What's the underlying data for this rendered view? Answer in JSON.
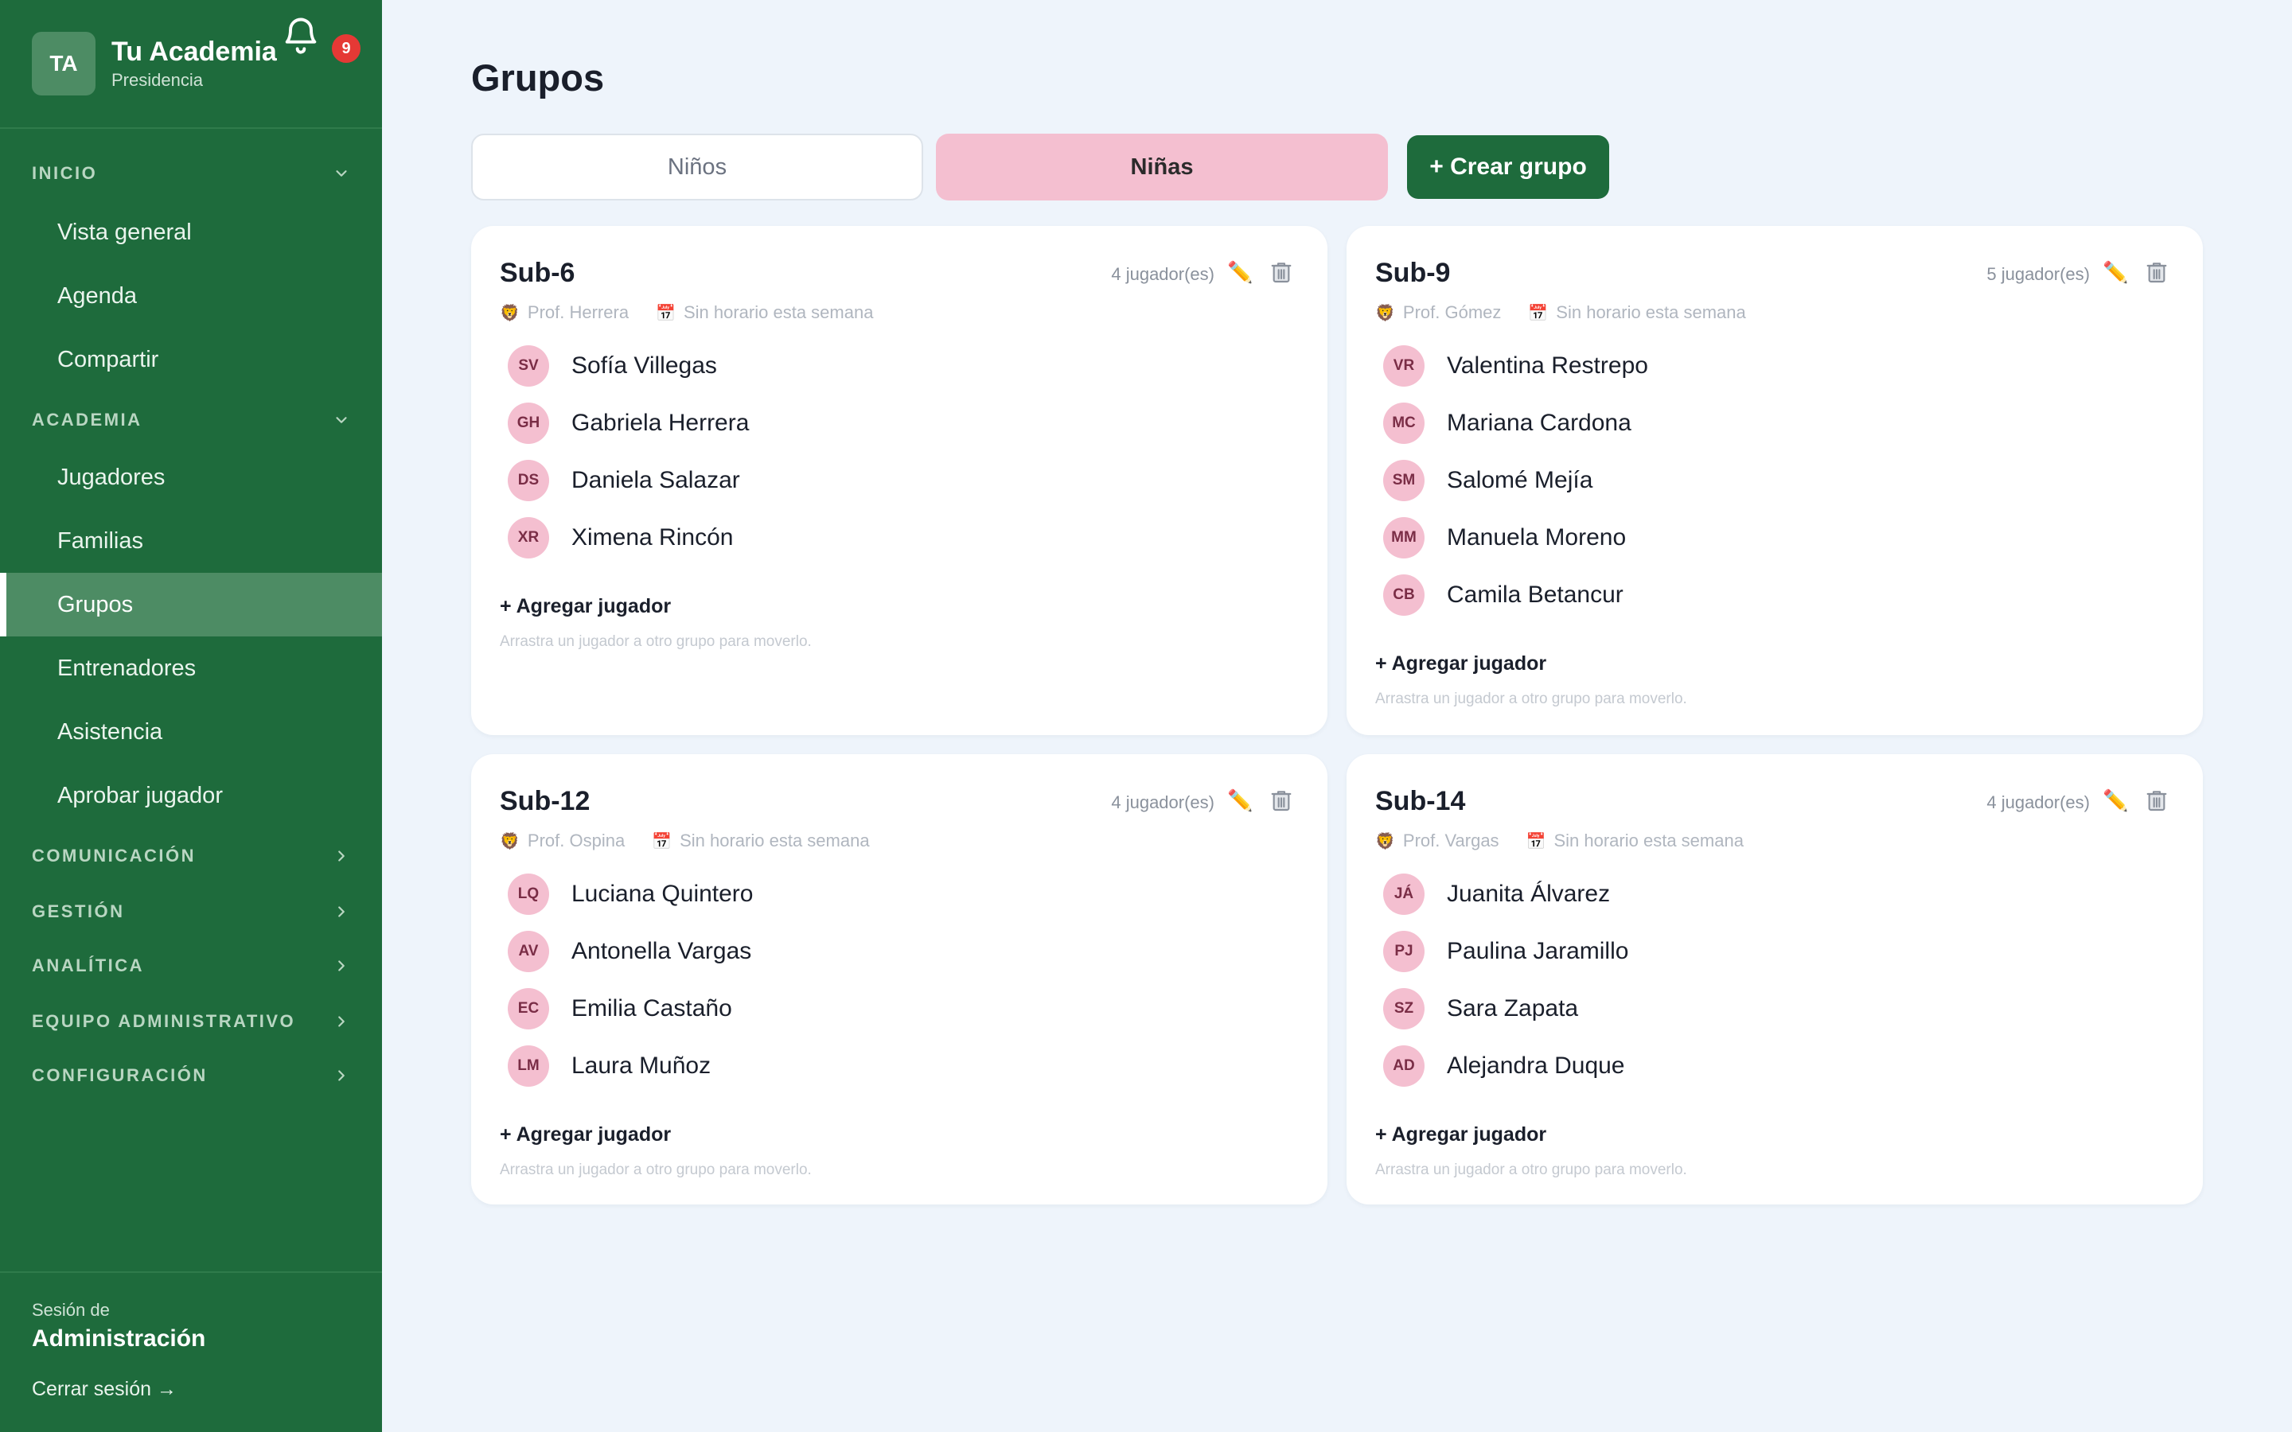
{
  "brand": {
    "initials": "TA",
    "name": "Tu Academia",
    "subtitle": "Presidencia",
    "notifications": "9"
  },
  "sidebar": {
    "sections": [
      {
        "label": "INICIO",
        "expanded": true,
        "items": [
          "Vista general",
          "Agenda",
          "Compartir"
        ]
      },
      {
        "label": "ACADEMIA",
        "expanded": true,
        "items": [
          "Jugadores",
          "Familias",
          "Grupos",
          "Entrenadores",
          "Asistencia",
          "Aprobar jugador"
        ]
      },
      {
        "label": "COMUNICACIÓN",
        "expanded": false,
        "items": []
      },
      {
        "label": "GESTIÓN",
        "expanded": false,
        "items": []
      },
      {
        "label": "ANALÍTICA",
        "expanded": false,
        "items": []
      },
      {
        "label": "EQUIPO ADMINISTRATIVO",
        "expanded": false,
        "items": []
      },
      {
        "label": "CONFIGURACIÓN",
        "expanded": false,
        "items": []
      }
    ],
    "active_item": "Grupos",
    "session_label": "Sesión de",
    "session_name": "Administración",
    "logout": "Cerrar sesión →"
  },
  "page": {
    "title": "Grupos",
    "tabs": [
      "Niños",
      "Niñas"
    ],
    "active_tab": "Niñas",
    "create_button": "+ Crear grupo"
  },
  "groups": [
    {
      "name": "Sub-6",
      "count": "4 jugador(es)",
      "coach": "Prof. Herrera",
      "schedule": "Sin horario esta semana",
      "players": [
        {
          "initials": "SV",
          "name": "Sofía Villegas"
        },
        {
          "initials": "GH",
          "name": "Gabriela Herrera"
        },
        {
          "initials": "DS",
          "name": "Daniela Salazar"
        },
        {
          "initials": "XR",
          "name": "Ximena Rincón"
        }
      ],
      "add_label": "+ Agregar jugador",
      "hint": "Arrastra un jugador a otro grupo para moverlo."
    },
    {
      "name": "Sub-9",
      "count": "5 jugador(es)",
      "coach": "Prof. Gómez",
      "schedule": "Sin horario esta semana",
      "players": [
        {
          "initials": "VR",
          "name": "Valentina Restrepo"
        },
        {
          "initials": "MC",
          "name": "Mariana Cardona"
        },
        {
          "initials": "SM",
          "name": "Salomé Mejía"
        },
        {
          "initials": "MM",
          "name": "Manuela Moreno"
        },
        {
          "initials": "CB",
          "name": "Camila Betancur"
        }
      ],
      "add_label": "+ Agregar jugador",
      "hint": "Arrastra un jugador a otro grupo para moverlo."
    },
    {
      "name": "Sub-12",
      "count": "4 jugador(es)",
      "coach": "Prof. Ospina",
      "schedule": "Sin horario esta semana",
      "players": [
        {
          "initials": "LQ",
          "name": "Luciana Quintero"
        },
        {
          "initials": "AV",
          "name": "Antonella Vargas"
        },
        {
          "initials": "EC",
          "name": "Emilia Castaño"
        },
        {
          "initials": "LM",
          "name": "Laura Muñoz"
        }
      ],
      "add_label": "+ Agregar jugador",
      "hint": "Arrastra un jugador a otro grupo para moverlo."
    },
    {
      "name": "Sub-14",
      "count": "4 jugador(es)",
      "coach": "Prof. Vargas",
      "schedule": "Sin horario esta semana",
      "players": [
        {
          "initials": "JÁ",
          "name": "Juanita Álvarez"
        },
        {
          "initials": "PJ",
          "name": "Paulina Jaramillo"
        },
        {
          "initials": "SZ",
          "name": "Sara Zapata"
        },
        {
          "initials": "AD",
          "name": "Alejandra Duque"
        }
      ],
      "add_label": "+ Agregar jugador",
      "hint": "Arrastra un jugador a otro grupo para moverlo."
    }
  ],
  "colors": {
    "sidebar": "#1e6b3c",
    "active_item": "#4d8c64",
    "accent_pink": "#f4bfd0",
    "background": "#eef4fb",
    "badge": "#e53935"
  },
  "icons": {
    "bell": "bell-icon",
    "edit": "pencil-icon",
    "delete": "trash-icon",
    "coach": "coach-icon",
    "schedule": "calendar-icon"
  }
}
